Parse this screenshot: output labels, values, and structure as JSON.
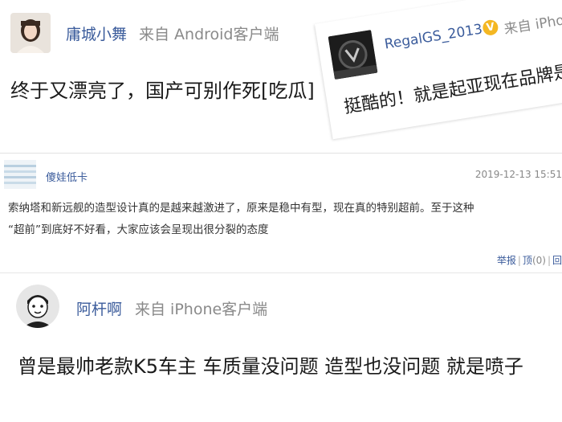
{
  "comment_1": {
    "username": "庸城小舞",
    "source": "来自 Android客户端",
    "text": "终于又漂亮了，国产可别作死[吃瓜]",
    "avatar_icon": "girl-portrait-avatar"
  },
  "comment_2": {
    "username": "RegalGS_2013",
    "badge": "V",
    "source": "来自 iPhone",
    "text": "挺酷的！就是起亚现在品牌是下",
    "avatar_icon": "car-badge-avatar",
    "badge_color": "#f4b722"
  },
  "comment_3": {
    "username": "傻娃低卡",
    "timestamp": "2019-12-13 15:51",
    "line_1": "索纳塔和新远舰的造型设计真的是越来越激进了，原来是稳中有型，现在真的特别超前。至于这种",
    "line_2": "“超前”到底好不好看，大家应该会呈现出很分裂的态度",
    "actions": {
      "report": "举报",
      "top": "顶",
      "top_count": "(0)",
      "reply": "回"
    },
    "avatar_icon": "striped-avatar"
  },
  "comment_4": {
    "username": "阿杆啊",
    "source": "来自 iPhone客户端",
    "text": "曾是最帅老款K5车主 车质量没问题 造型也没问题 就是喷子",
    "avatar_icon": "cartoon-man-avatar"
  },
  "colors": {
    "username": "#3a5b9b",
    "source": "#8a8a8a",
    "text": "#1a1a1a"
  }
}
